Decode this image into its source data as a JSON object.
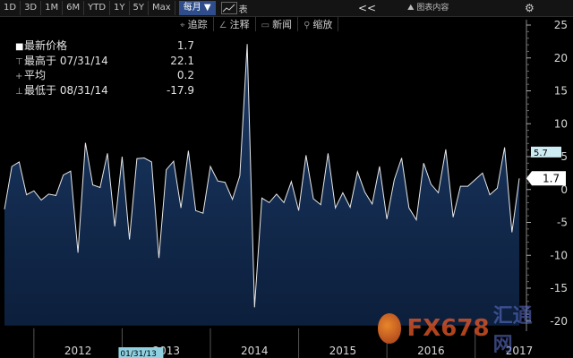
{
  "toolbar": {
    "timeframes": [
      "1D",
      "3D",
      "1M",
      "6M",
      "YTD",
      "1Y",
      "5Y",
      "Max"
    ],
    "frequency": "每月 ▼",
    "chart_type_label": "表",
    "collapse": "<<",
    "content_label": "图表内容",
    "settings_icon": "gear-icon"
  },
  "tools": [
    {
      "icon": "crosshair-icon",
      "glyph": "⌖",
      "label": "追踪"
    },
    {
      "icon": "pencil-icon",
      "glyph": "∠",
      "label": "注释"
    },
    {
      "icon": "news-icon",
      "glyph": "▭",
      "label": "新闻"
    },
    {
      "icon": "zoom-icon",
      "glyph": "⚲",
      "label": "缩放"
    }
  ],
  "legend": {
    "rows": [
      {
        "label": "最新价格",
        "value": "1.7"
      },
      {
        "label": "最高于 07/31/14",
        "value": "22.1"
      },
      {
        "label": "平均",
        "value": "0.2"
      },
      {
        "label": "最低于 08/31/14",
        "value": "-17.9"
      }
    ]
  },
  "watermark": {
    "text1": "FX678",
    "text2": "汇通网"
  },
  "colors": {
    "accent": "#2e4d8a",
    "line": "#e8e8e8",
    "fill_top": "#1c3a66",
    "fill_bottom": "#0c1f3c",
    "value_tag": "#ffffff",
    "prev_tag": "#cdebf3"
  },
  "chart_data": {
    "type": "area",
    "title": "",
    "xlabel": "",
    "ylabel": "",
    "ylim": [
      -20,
      25
    ],
    "y_ticks": [
      25,
      20,
      15,
      10,
      5,
      0,
      -5,
      -10,
      -15,
      -20
    ],
    "x_ticks": [
      "2012",
      "2013",
      "2014",
      "2015",
      "2016",
      "2017"
    ],
    "cursor_label": "01/31/13",
    "last_value_tag": "1.7",
    "prev_value_tag": "5.7",
    "grid": false,
    "x_start": "2011-09",
    "x_end": "2017-09",
    "series": [
      {
        "name": "",
        "values": [
          -3.0,
          3.5,
          4.2,
          -0.8,
          -0.2,
          -1.6,
          -0.7,
          -0.9,
          2.2,
          2.8,
          -9.6,
          7.1,
          0.7,
          0.3,
          5.5,
          -5.6,
          5.0,
          -7.6,
          4.7,
          4.8,
          4.2,
          -10.4,
          3.0,
          4.3,
          -2.8,
          5.9,
          -3.2,
          -3.6,
          3.5,
          1.3,
          1.1,
          -1.5,
          2.1,
          22.1,
          -17.9,
          -1.3,
          -2.0,
          -0.7,
          -2.0,
          1.2,
          -3.2,
          5.2,
          -1.4,
          -2.3,
          5.5,
          -2.8,
          -0.5,
          -2.7,
          2.7,
          -0.4,
          -2.2,
          3.5,
          -4.5,
          1.5,
          4.8,
          -2.8,
          -4.6,
          4.0,
          0.8,
          -0.5,
          6.1,
          -4.2,
          0.5,
          0.5,
          1.5,
          2.5,
          -0.8,
          0.2,
          6.4,
          -6.5,
          1.7
        ]
      }
    ]
  }
}
